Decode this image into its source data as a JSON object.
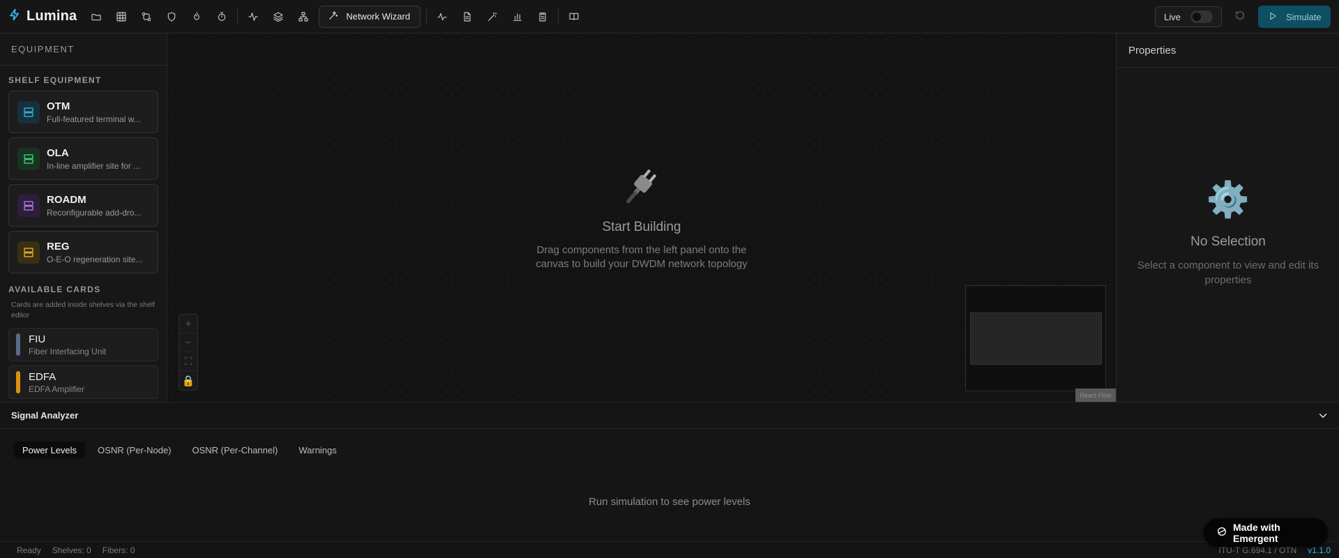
{
  "app": {
    "name": "Lumina",
    "wizard_label": "Network Wizard",
    "live_label": "Live",
    "simulate_label": "Simulate"
  },
  "toolbar": {
    "icons": [
      "folder-open-icon",
      "grid-icon",
      "git-compare-icon",
      "shield-icon",
      "flame-icon",
      "timer-icon",
      "activity-icon",
      "layers-icon",
      "network-icon",
      "wand-icon",
      "pulse-icon",
      "document-icon",
      "magic-wand-icon",
      "bar-chart-icon",
      "clipboard-icon",
      "book-open-icon",
      "refresh-icon",
      "play-icon"
    ]
  },
  "left_panel": {
    "header": "EQUIPMENT",
    "shelf_title": "SHELF EQUIPMENT",
    "shelf": [
      {
        "name": "OTM",
        "desc": "Full-featured terminal w...",
        "color": "#38bdf8",
        "bg": "#16313d"
      },
      {
        "name": "OLA",
        "desc": "In-line amplifier site for ...",
        "color": "#4ade80",
        "bg": "#173322"
      },
      {
        "name": "ROADM",
        "desc": "Reconfigurable add-dro...",
        "color": "#c084fc",
        "bg": "#2d1f3b"
      },
      {
        "name": "REG",
        "desc": "O-E-O regeneration site...",
        "color": "#fbbf24",
        "bg": "#3a2f14"
      }
    ],
    "cards_title": "AVAILABLE CARDS",
    "cards_note": "Cards are added inside shelves via the shelf editor",
    "cards": [
      {
        "name": "FIU",
        "desc": "Fiber Interfacing Unit",
        "color": "#5b6b8a"
      },
      {
        "name": "EDFA",
        "desc": "EDFA Amplifier",
        "color": "#d99211"
      }
    ]
  },
  "canvas": {
    "empty_title": "Start Building",
    "empty_line1": "Drag components from the left panel onto the",
    "empty_line2": "canvas to build your DWDM network topology",
    "zoom_controls": [
      "+",
      "−",
      "⛶",
      "🔒"
    ],
    "attribution": "React Flow"
  },
  "properties": {
    "header": "Properties",
    "empty_icon": "⚙️",
    "empty_title": "No Selection",
    "empty_text": "Select a component to view and edit its properties"
  },
  "analyzer": {
    "title": "Signal Analyzer",
    "tabs": [
      "Power Levels",
      "OSNR (Per-Node)",
      "OSNR (Per-Channel)",
      "Warnings"
    ],
    "active_tab": "Power Levels",
    "empty_message": "Run simulation to see power levels"
  },
  "status": {
    "state": "Ready",
    "shelves": "Shelves: 0",
    "fibers": "Fibers: 0",
    "standard": "ITU-T G.694.1 / OTN",
    "version": "v1.1.0"
  },
  "badge": {
    "label": "Made with Emergent"
  }
}
